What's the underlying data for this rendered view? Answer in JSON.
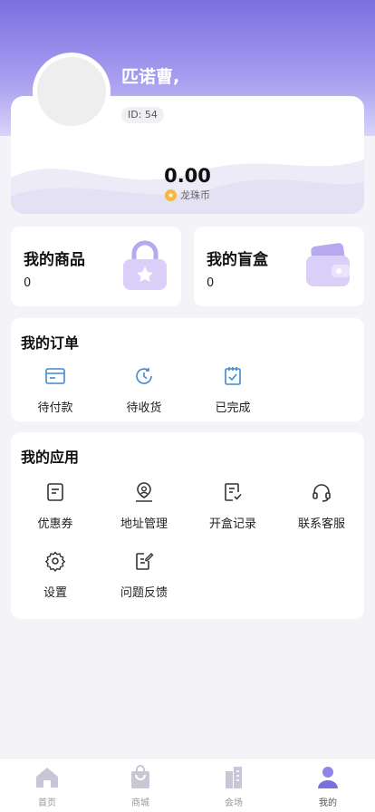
{
  "profile": {
    "username": "匹诺曹,",
    "user_id": "ID: 54",
    "balance": "0.00",
    "currency_label": "龙珠币"
  },
  "assets": {
    "goods_title": "我的商品",
    "goods_count": "0",
    "blindbox_title": "我的盲盒",
    "blindbox_count": "0"
  },
  "orders": {
    "title": "我的订单",
    "items": [
      {
        "label": "待付款",
        "icon": "wallet-card-icon"
      },
      {
        "label": "待收货",
        "icon": "clock-icon"
      },
      {
        "label": "已完成",
        "icon": "checked-clipboard-icon"
      }
    ]
  },
  "apps": {
    "title": "我的应用",
    "items": [
      {
        "label": "优惠券",
        "icon": "coupon-icon"
      },
      {
        "label": "地址管理",
        "icon": "location-user-icon"
      },
      {
        "label": "开盒记录",
        "icon": "record-icon"
      },
      {
        "label": "联系客服",
        "icon": "headset-icon"
      },
      {
        "label": "设置",
        "icon": "gear-icon"
      },
      {
        "label": "问题反馈",
        "icon": "feedback-edit-icon"
      }
    ]
  },
  "tabbar": {
    "items": [
      {
        "label": "首页",
        "icon": "home-icon"
      },
      {
        "label": "商城",
        "icon": "shopping-bag-icon"
      },
      {
        "label": "会场",
        "icon": "building-icon"
      },
      {
        "label": "我的",
        "icon": "user-icon"
      }
    ],
    "active": "我的"
  },
  "colors": {
    "accent": "#7b6fe0",
    "orders_icon": "#3d8ad6",
    "app_icon": "#333333"
  }
}
